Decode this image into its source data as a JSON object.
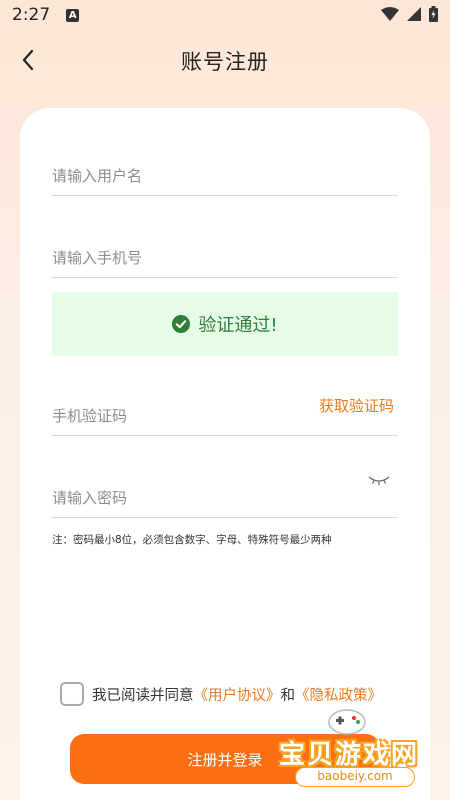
{
  "status_bar": {
    "time": "2:27",
    "a_badge": "A"
  },
  "nav": {
    "title": "账号注册",
    "back_icon": "chevron-left-icon"
  },
  "form": {
    "username_placeholder": "请输入用户名",
    "phone_placeholder": "请输入手机号",
    "verify_status": "验证通过!",
    "sms_code_placeholder": "手机验证码",
    "get_code_label": "获取验证码",
    "password_placeholder": "请输入密码",
    "password_hint": "注：密码最小8位，必须包含数字、字母、特殊符号最少两种"
  },
  "agreement": {
    "checked": false,
    "prefix": "我已阅读并同意",
    "user_agreement": "《用户协议》",
    "and": "和",
    "privacy_policy": "《隐私政策》"
  },
  "submit_label": "注册并登录",
  "watermark": {
    "text": "宝贝游戏网",
    "url": "baobeiy.com"
  },
  "colors": {
    "accent": "#fb6f10",
    "link": "#ee7a1b",
    "success_bg": "#e7fbe9",
    "success_text": "#2f7f38"
  }
}
